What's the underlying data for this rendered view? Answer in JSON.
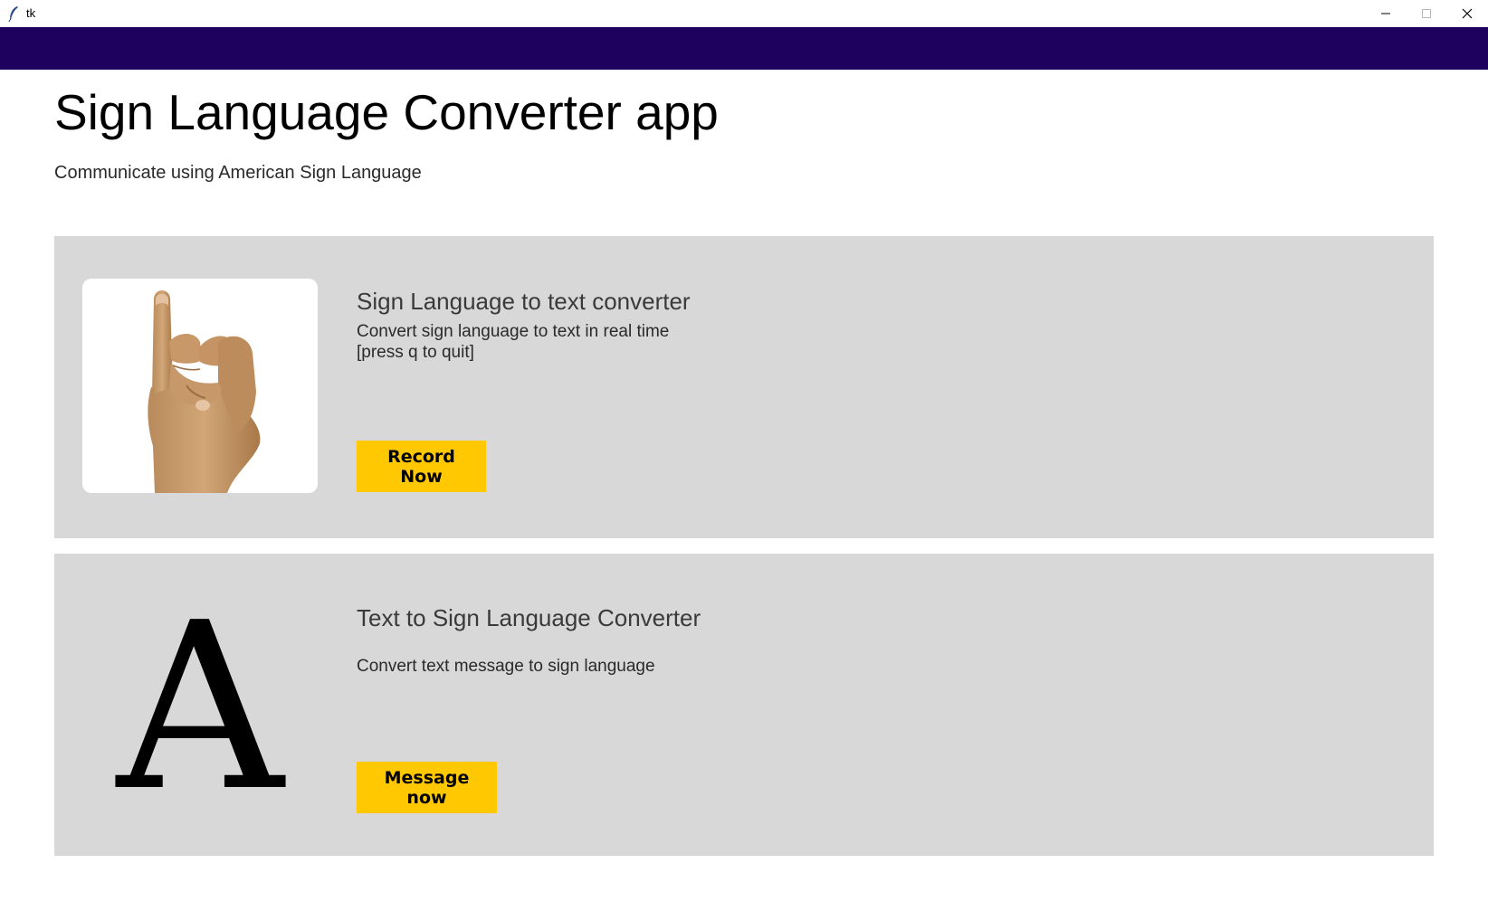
{
  "window": {
    "title": "tk",
    "controls": [
      "minimize-icon",
      "maximize-icon",
      "close-icon"
    ]
  },
  "colors": {
    "banner": "#1e005e",
    "card_background": "#d8d8d8",
    "button_background": "#ffc800"
  },
  "header": {
    "title": "Sign Language Converter app",
    "subtitle": "Communicate using American Sign Language"
  },
  "cards": [
    {
      "heading": "Sign Language to text converter",
      "description_line1": "Convert sign language to text in real time",
      "description_line2": "[press q to quit]",
      "image": "hand-sign-icon",
      "button_label": "Record Now"
    },
    {
      "heading": "Text to Sign Language Converter",
      "description_line1": "Convert text message to sign language",
      "image_text": "A",
      "button_label": "Message now"
    }
  ]
}
